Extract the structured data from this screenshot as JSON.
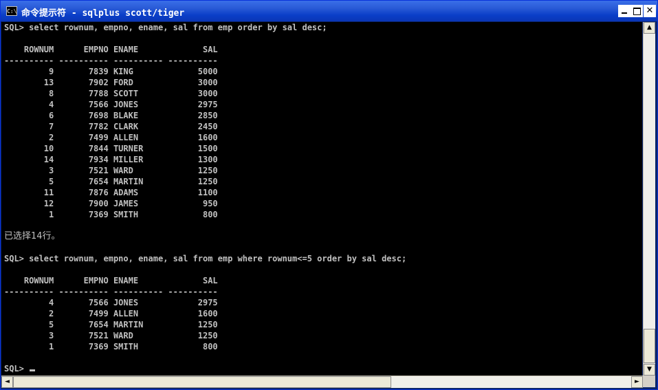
{
  "window": {
    "title": "命令提示符 - sqlplus scott/tiger",
    "icon_label": "C:\\"
  },
  "console": {
    "lines": [
      "SQL> select rownum, empno, ename, sal from emp order by sal desc;",
      "",
      "    ROWNUM      EMPNO ENAME             SAL",
      "---------- ---------- ---------- ----------",
      "         9       7839 KING             5000",
      "        13       7902 FORD             3000",
      "         8       7788 SCOTT            3000",
      "         4       7566 JONES            2975",
      "         6       7698 BLAKE            2850",
      "         7       7782 CLARK            2450",
      "         2       7499 ALLEN            1600",
      "        10       7844 TURNER           1500",
      "        14       7934 MILLER           1300",
      "         3       7521 WARD             1250",
      "         5       7654 MARTIN           1250",
      "        11       7876 ADAMS            1100",
      "        12       7900 JAMES             950",
      "         1       7369 SMITH             800",
      "",
      "已选择14行。",
      "",
      "SQL> select rownum, empno, ename, sal from emp where rownum<=5 order by sal desc;",
      "",
      "    ROWNUM      EMPNO ENAME             SAL",
      "---------- ---------- ---------- ----------",
      "         4       7566 JONES            2975",
      "         2       7499 ALLEN            1600",
      "         5       7654 MARTIN           1250",
      "         3       7521 WARD             1250",
      "         1       7369 SMITH             800",
      ""
    ],
    "prompt": "SQL> "
  },
  "scrollbars": {
    "up": "▲",
    "down": "▼",
    "left": "◄",
    "right": "►"
  }
}
